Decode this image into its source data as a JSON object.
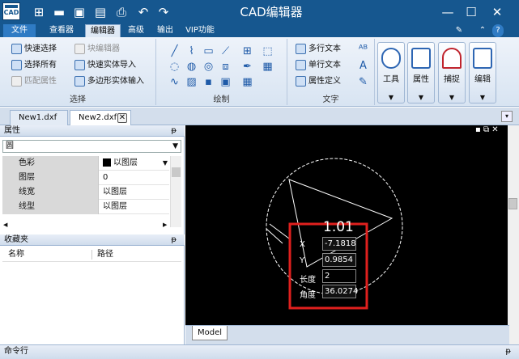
{
  "app": {
    "title": "CAD编辑器",
    "logo": "CAD"
  },
  "quick_access": [
    "new-icon",
    "open-icon",
    "save-icon",
    "save-as-icon",
    "print-icon",
    "undo-icon",
    "redo-icon"
  ],
  "menu": {
    "file": "文件",
    "tabs": [
      "查看器",
      "编辑器",
      "高级",
      "输出",
      "VIP功能"
    ]
  },
  "ribbon": {
    "select": {
      "label": "选择",
      "quick_select": "快速选择",
      "select_all": "选择所有",
      "match_props": "匹配属性",
      "block_editor": "块编辑器",
      "quick_block_import": "快速实体导入",
      "poly_import": "多边形实体输入"
    },
    "draw": {
      "label": "绘制"
    },
    "text": {
      "label": "文字",
      "mtext": "多行文本",
      "stext": "单行文本",
      "attdef": "属性定义"
    },
    "big": {
      "tools": "工具",
      "props": "属性",
      "snap": "捕捉",
      "edit": "编辑"
    }
  },
  "tabs": [
    "New1.dxf",
    "New2.dxf"
  ],
  "properties": {
    "title": "属性",
    "object": "圆",
    "rows": [
      {
        "k": "色彩",
        "v": "以图层"
      },
      {
        "k": "图层",
        "v": "0"
      },
      {
        "k": "线宽",
        "v": "以图层"
      },
      {
        "k": "线型",
        "v": "以图层"
      }
    ]
  },
  "favorites": {
    "title": "收藏夹",
    "col_name": "名称",
    "col_path": "路径"
  },
  "drawing": {
    "dimension": "1.01",
    "fields": [
      {
        "label": "X",
        "value": "-7.1818"
      },
      {
        "label": "Y",
        "value": "0.9854"
      },
      {
        "label": "长度",
        "value": "2"
      },
      {
        "label": "角度",
        "value": "36.0274"
      }
    ]
  },
  "model_tab": "Model",
  "command_bar": "命令行",
  "colors": {
    "title_bg": "#16578f",
    "highlight": "#e0201e"
  }
}
